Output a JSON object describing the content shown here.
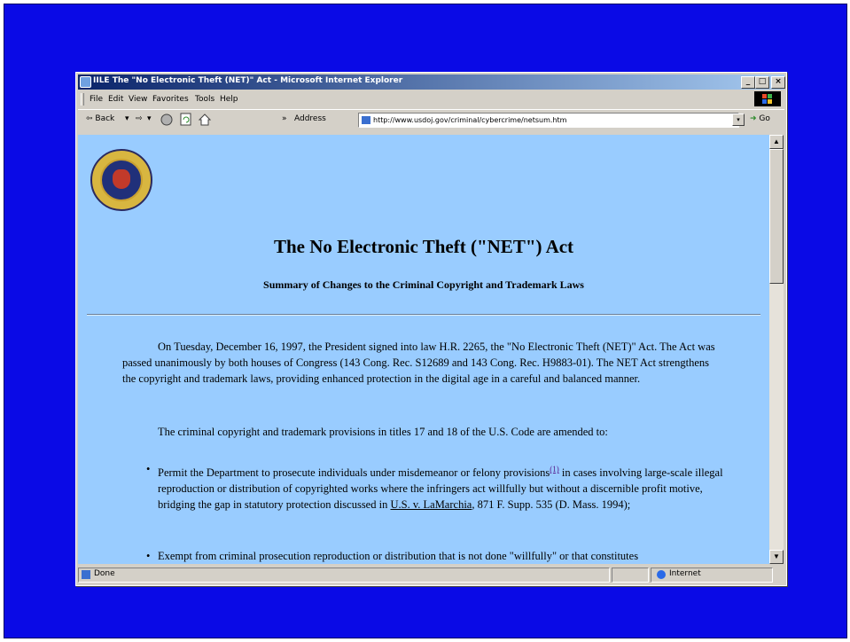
{
  "window": {
    "title": "IILE The \"No Electronic Theft (NET)\" Act - Microsoft Internet Explorer",
    "min": "_",
    "max": "□",
    "close": "×"
  },
  "menu": [
    "File",
    "Edit",
    "View",
    "Favorites",
    "Tools",
    "Help"
  ],
  "toolbar": {
    "back": "⇦ Back",
    "back_drop": "▾",
    "forward": "⇨",
    "forward_drop": "▾",
    "chevron": "»",
    "address_label": "Address",
    "address_value": "http://www.usdoj.gov/criminal/cybercrime/netsum.htm",
    "drop": "▾",
    "go": "Go"
  },
  "page": {
    "title": "The No Electronic Theft (\"NET\") Act",
    "subtitle": "Summary of Changes to the Criminal Copyright and Trademark Laws",
    "para1": "On Tuesday, December 16, 1997, the President signed into law H.R. 2265, the \"No Electronic Theft (NET)\" Act. The Act was passed unanimously by both houses of Congress (143 Cong. Rec. S12689 and 143 Cong. Rec. H9883-01). The NET Act strengthens the copyright and trademark laws, providing enhanced protection in the digital age in a careful and balanced manner.",
    "para2": "The criminal copyright and trademark provisions in titles 17 and 18 of the U.S. Code are amended to:",
    "bullet1_a": "Permit the Department to prosecute individuals under misdemeanor or felony provisions",
    "bullet1_sup": "(1)",
    "bullet1_b": " in cases involving large-scale illegal reproduction or distribution of copyrighted works where the infringers act willfully but without a discernible profit motive, bridging the gap in statutory protection discussed in ",
    "bullet1_link": "U.S. v. LaMarchia",
    "bullet1_c": ", 871 F. Supp. 535 (D. Mass. 1994);",
    "bullet2": "Exempt from criminal prosecution reproduction or distribution that is not done \"willfully\" or that constitutes"
  },
  "status": {
    "left": "Done",
    "zone": "Internet"
  },
  "scroll": {
    "up": "▲",
    "down": "▼"
  }
}
